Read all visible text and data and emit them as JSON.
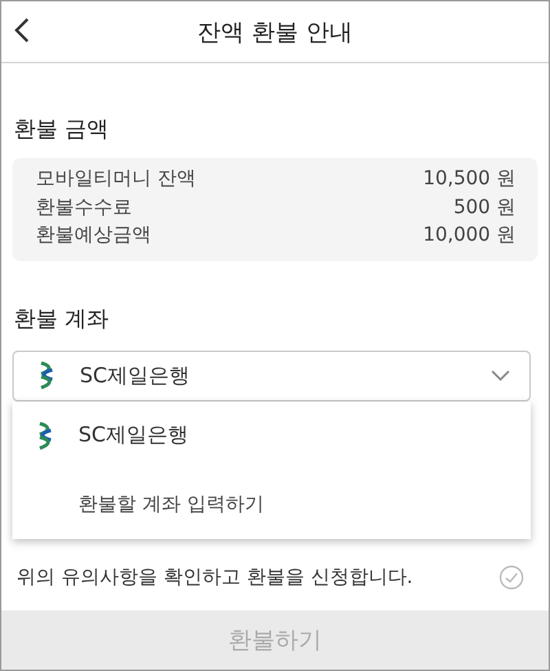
{
  "header": {
    "title": "잔액 환불 안내"
  },
  "amount_section": {
    "title": "환불 금액",
    "rows": [
      {
        "label": "모바일티머니 잔액",
        "value": "10,500 원"
      },
      {
        "label": "환불수수료",
        "value": "500 원"
      },
      {
        "label": "환불예상금액",
        "value": "10,000 원"
      }
    ]
  },
  "account_section": {
    "title": "환불 계좌",
    "select": {
      "value": "SC제일은행",
      "expanded": true
    },
    "options": [
      {
        "label": "SC제일은행",
        "kind": "bank"
      },
      {
        "label": "환불할 계좌 입력하기",
        "kind": "manual"
      }
    ]
  },
  "agreement": {
    "text": "위의 유의사항을 확인하고 환불을 신청합니다.",
    "checked": false
  },
  "submit": {
    "label": "환불하기",
    "disabled": true
  }
}
